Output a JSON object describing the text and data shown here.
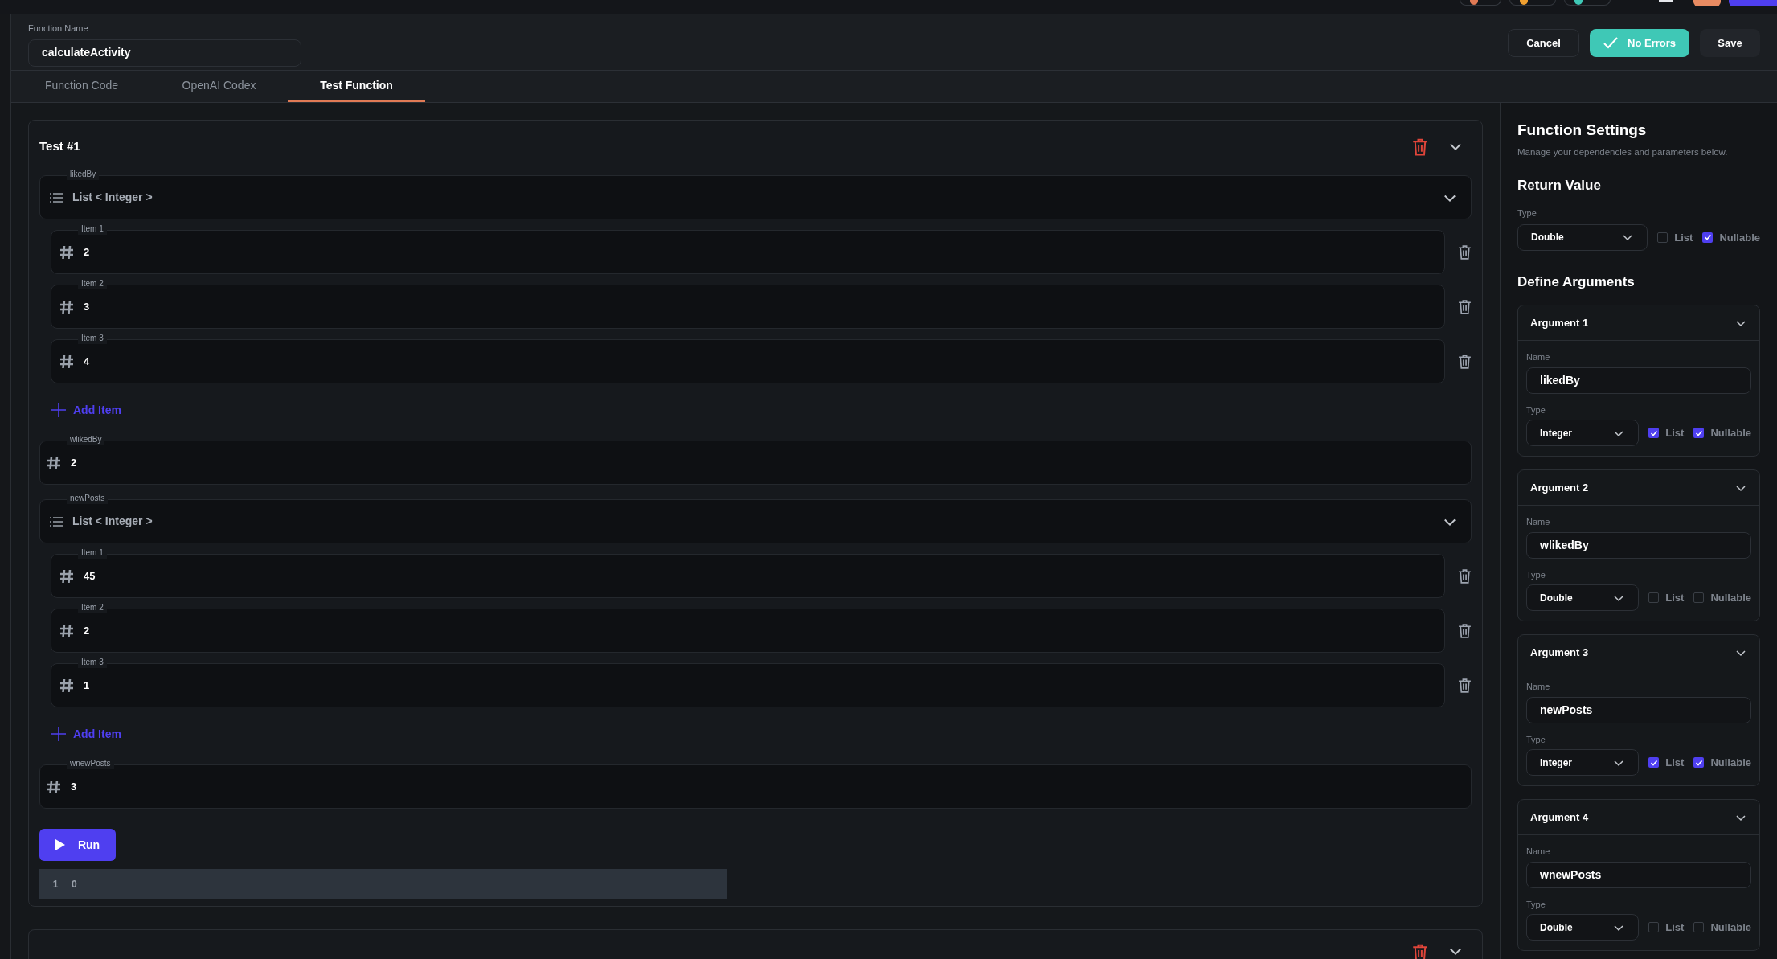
{
  "header": {
    "function_name_label": "Function Name",
    "function_name": "calculateActivity",
    "cancel_label": "Cancel",
    "status": {
      "kind": "ok",
      "label": "No Errors"
    },
    "save_label": "Save"
  },
  "tabs": [
    {
      "label": "Function Code",
      "selected": false
    },
    {
      "label": "OpenAI Codex",
      "selected": false
    },
    {
      "label": "Test Function",
      "selected": true
    }
  ],
  "tests": [
    {
      "title": "Test #1",
      "params": [
        {
          "kind": "list",
          "label": "likedBy",
          "type_label": "List < Integer >",
          "items": [
            {
              "label": "Item 1",
              "value": "2"
            },
            {
              "label": "Item 2",
              "value": "3"
            },
            {
              "label": "Item 3",
              "value": "4"
            }
          ],
          "add_label": "Add Item"
        },
        {
          "kind": "number",
          "label": "wlikedBy",
          "value": "2"
        },
        {
          "kind": "list",
          "label": "newPosts",
          "type_label": "List < Integer >",
          "items": [
            {
              "label": "Item 1",
              "value": "45"
            },
            {
              "label": "Item 2",
              "value": "2"
            },
            {
              "label": "Item 3",
              "value": "1"
            }
          ],
          "add_label": "Add Item"
        },
        {
          "kind": "number",
          "label": "wnewPosts",
          "value": "3"
        }
      ],
      "run_label": "Run",
      "output": {
        "line_number": "1",
        "text": "0"
      }
    }
  ],
  "settings": {
    "title": "Function Settings",
    "subtitle": "Manage your dependencies and parameters below.",
    "return_title": "Return Value",
    "return_type_label": "Type",
    "return_type": "Double",
    "return_list": {
      "label": "List",
      "checked": false
    },
    "return_nullable": {
      "label": "Nullable",
      "checked": true
    },
    "arguments_title": "Define Arguments",
    "arguments": [
      {
        "title": "Argument 1",
        "name_label": "Name",
        "name": "likedBy",
        "type_label": "Type",
        "type": "Integer",
        "list": {
          "label": "List",
          "checked": true
        },
        "nullable": {
          "label": "Nullable",
          "checked": true
        }
      },
      {
        "title": "Argument 2",
        "name_label": "Name",
        "name": "wlikedBy",
        "type_label": "Type",
        "type": "Double",
        "list": {
          "label": "List",
          "checked": false
        },
        "nullable": {
          "label": "Nullable",
          "checked": false
        }
      },
      {
        "title": "Argument 3",
        "name_label": "Name",
        "name": "newPosts",
        "type_label": "Type",
        "type": "Integer",
        "list": {
          "label": "List",
          "checked": true
        },
        "nullable": {
          "label": "Nullable",
          "checked": true
        }
      },
      {
        "title": "Argument 4",
        "name_label": "Name",
        "name": "wnewPosts",
        "type_label": "Type",
        "type": "Double",
        "list": {
          "label": "List",
          "checked": false
        },
        "nullable": {
          "label": "Nullable",
          "checked": false
        }
      }
    ]
  }
}
